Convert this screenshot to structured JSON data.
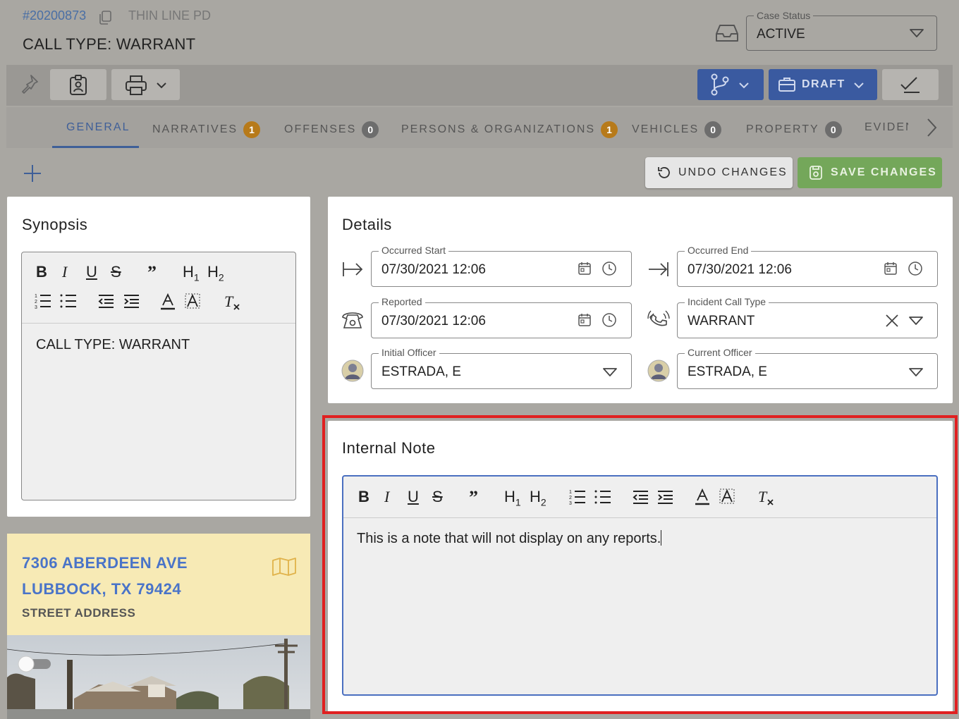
{
  "header": {
    "case_number": "#20200873",
    "agency": "THIN LINE PD",
    "call_type_title": "CALL TYPE: WARRANT",
    "case_status": {
      "label": "Case Status",
      "value": "ACTIVE"
    }
  },
  "toolbar": {
    "draft_label": "DRAFT"
  },
  "tabs": [
    {
      "label": "GENERAL",
      "count": null,
      "active": true
    },
    {
      "label": "NARRATIVES",
      "count": "1",
      "count_color": "orange"
    },
    {
      "label": "OFFENSES",
      "count": "0",
      "count_color": "grey"
    },
    {
      "label": "PERSONS & ORGANIZATIONS",
      "count": "1",
      "count_color": "orange"
    },
    {
      "label": "VEHICLES",
      "count": "0",
      "count_color": "grey"
    },
    {
      "label": "PROPERTY",
      "count": "0",
      "count_color": "grey"
    },
    {
      "label": "EVIDEN",
      "count": null
    }
  ],
  "actions": {
    "undo_label": "UNDO CHANGES",
    "save_label": "SAVE CHANGES"
  },
  "synopsis": {
    "title": "Synopsis",
    "text": "CALL TYPE: WARRANT"
  },
  "details": {
    "title": "Details",
    "occurred_start": {
      "label": "Occurred Start",
      "value": "07/30/2021 12:06"
    },
    "occurred_end": {
      "label": "Occurred End",
      "value": "07/30/2021 12:06"
    },
    "reported": {
      "label": "Reported",
      "value": "07/30/2021 12:06"
    },
    "incident_call_type": {
      "label": "Incident Call Type",
      "value": "WARRANT"
    },
    "initial_officer": {
      "label": "Initial Officer",
      "value": "ESTRADA, E"
    },
    "current_officer": {
      "label": "Current Officer",
      "value": "ESTRADA, E"
    }
  },
  "internal_note": {
    "title": "Internal Note",
    "text": "This is a note that will not display on any reports."
  },
  "address": {
    "line1": "7306 ABERDEEN AVE",
    "line2": "LUBBOCK, TX 79424",
    "type": "STREET ADDRESS"
  },
  "colors": {
    "primary": "#3a5aa0",
    "save_green": "#74a75a",
    "badge_orange": "#b77a1a",
    "highlight_red": "#e02020",
    "address_bg": "#f7eab5"
  }
}
